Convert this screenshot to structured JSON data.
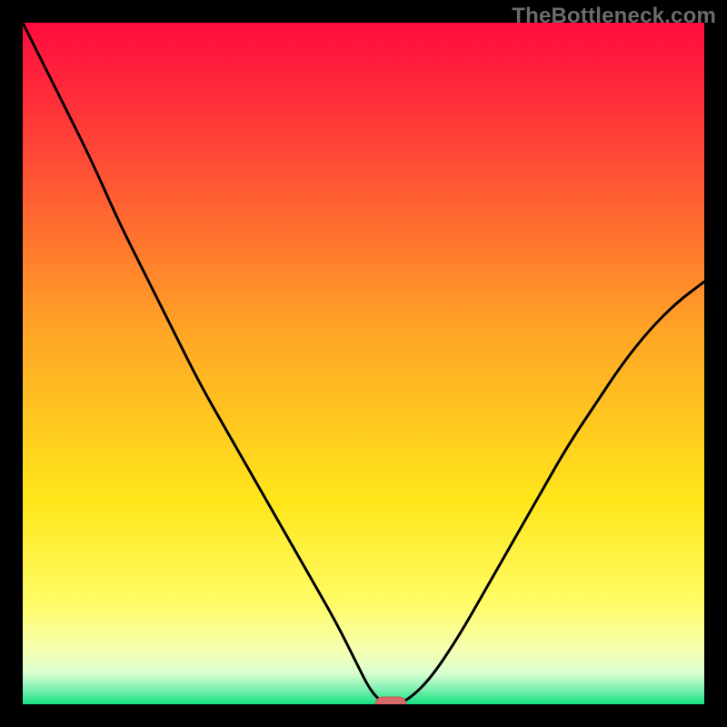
{
  "watermark": "TheBottleneck.com",
  "colors": {
    "black": "#000000",
    "curve": "#000000",
    "marker_fill": "#d86b68",
    "marker_stroke": "#bf5a57",
    "gradient_stops": [
      {
        "offset": 0.0,
        "color": "#ff0b3e"
      },
      {
        "offset": 0.2,
        "color": "#ff4a36"
      },
      {
        "offset": 0.45,
        "color": "#ffa426"
      },
      {
        "offset": 0.7,
        "color": "#ffe61a"
      },
      {
        "offset": 0.85,
        "color": "#fffc66"
      },
      {
        "offset": 0.92,
        "color": "#f6ffb0"
      },
      {
        "offset": 0.955,
        "color": "#d8ffcf"
      },
      {
        "offset": 0.975,
        "color": "#8af2b6"
      },
      {
        "offset": 1.0,
        "color": "#14e080"
      }
    ]
  },
  "chart_data": {
    "type": "line",
    "title": "",
    "xlabel": "",
    "ylabel": "",
    "xlim": [
      0,
      100
    ],
    "ylim": [
      0,
      100
    ],
    "x": [
      0,
      3,
      6,
      10,
      14,
      18,
      22,
      26,
      30,
      34,
      38,
      42,
      46,
      49,
      51,
      53,
      55,
      57,
      60,
      64,
      68,
      72,
      76,
      80,
      84,
      88,
      92,
      96,
      100
    ],
    "values": [
      100,
      94,
      88,
      80,
      71,
      63,
      55,
      47,
      40,
      33,
      26,
      19,
      12,
      6,
      2,
      0,
      0,
      1,
      4,
      10,
      17,
      24,
      31,
      38,
      44,
      50,
      55,
      59,
      62
    ],
    "marker": {
      "x": 54,
      "y": 0
    },
    "legend": null,
    "annotations": []
  }
}
